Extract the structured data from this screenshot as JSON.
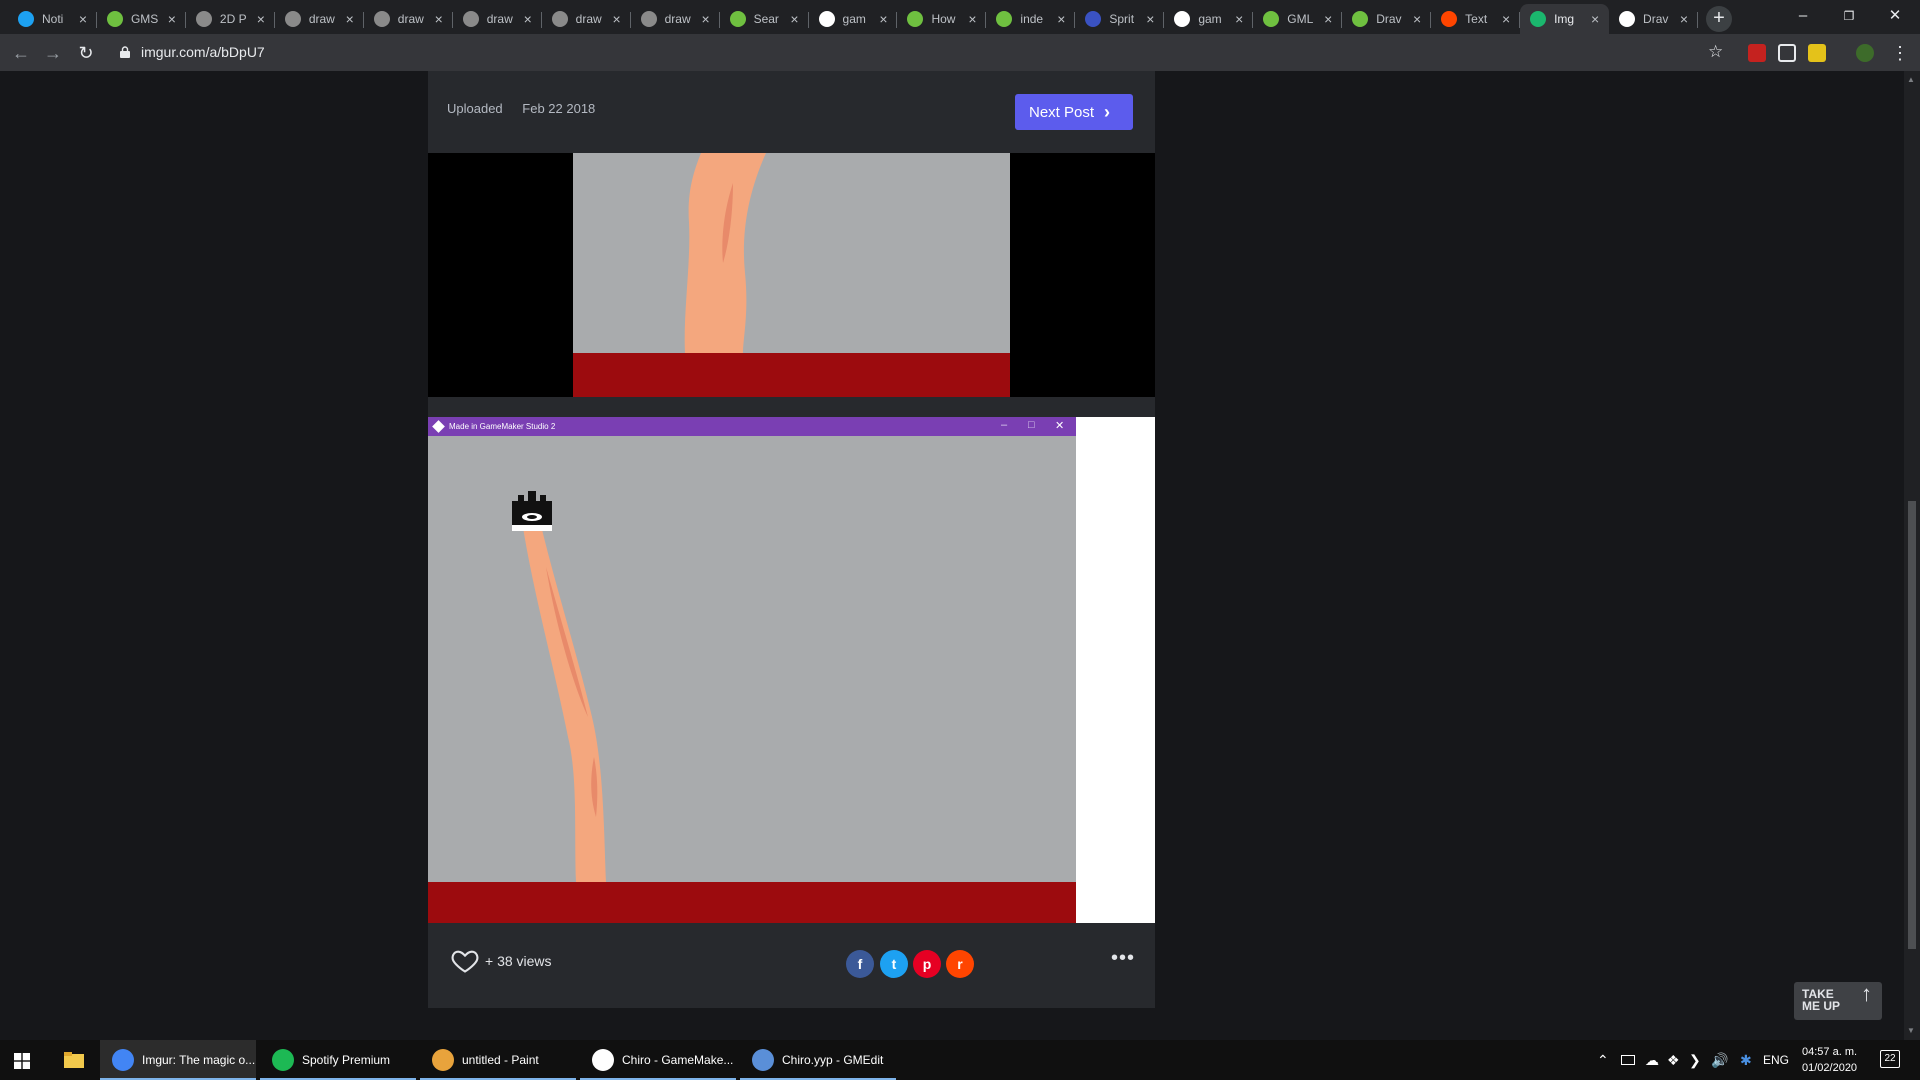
{
  "browser": {
    "tabs": [
      {
        "title": "Noti",
        "favicon": "twitter-icon",
        "color": "#1da1f2"
      },
      {
        "title": "GMS",
        "favicon": "gm-forum-icon",
        "color": "#6fc040"
      },
      {
        "title": "2D P",
        "favicon": "globe-icon",
        "color": "#8a8a8a"
      },
      {
        "title": "draw",
        "favicon": "globe-icon",
        "color": "#8a8a8a"
      },
      {
        "title": "draw",
        "favicon": "globe-icon",
        "color": "#8a8a8a"
      },
      {
        "title": "draw",
        "favicon": "globe-icon",
        "color": "#8a8a8a"
      },
      {
        "title": "draw",
        "favicon": "globe-icon",
        "color": "#8a8a8a"
      },
      {
        "title": "draw",
        "favicon": "globe-icon",
        "color": "#8a8a8a"
      },
      {
        "title": "Sear",
        "favicon": "gm-forum-icon",
        "color": "#6fc040"
      },
      {
        "title": "gam",
        "favicon": "google-icon",
        "color": "#ffffff"
      },
      {
        "title": "How",
        "favicon": "gm-forum-icon",
        "color": "#6fc040"
      },
      {
        "title": "inde",
        "favicon": "gm-forum-icon",
        "color": "#6fc040"
      },
      {
        "title": "Sprit",
        "favicon": "spriters-icon",
        "color": "#3a52c2"
      },
      {
        "title": "gam",
        "favicon": "google-icon",
        "color": "#ffffff"
      },
      {
        "title": "GML",
        "favicon": "gm-forum-icon",
        "color": "#6fc040"
      },
      {
        "title": "Drav",
        "favicon": "gm-forum-icon",
        "color": "#6fc040"
      },
      {
        "title": "Text",
        "favicon": "reddit-icon",
        "color": "#ff4500"
      },
      {
        "title": "Img",
        "favicon": "imgur-icon",
        "color": "#1bb76e",
        "active": true
      },
      {
        "title": "Drav",
        "favicon": "gamemaker-icon",
        "color": "#ffffff"
      }
    ],
    "url": "imgur.com/a/bDpU7"
  },
  "post": {
    "uploaded_label": "Uploaded",
    "uploaded_date": "Feb 22 2018",
    "next_post_label": "Next Post",
    "gm_window_title": "Made in GameMaker Studio 2",
    "views_text": "+  38 views",
    "share_buttons": [
      {
        "name": "facebook-share-button",
        "glyph": "f",
        "color": "#3b5998"
      },
      {
        "name": "twitter-share-button",
        "glyph": "t",
        "color": "#1da1f2"
      },
      {
        "name": "pinterest-share-button",
        "glyph": "p",
        "color": "#e60023"
      },
      {
        "name": "reddit-share-button",
        "glyph": "r",
        "color": "#ff4500"
      }
    ],
    "more_label": "•••",
    "take_me_up": [
      "TAKE",
      "ME UP"
    ]
  },
  "taskbar": {
    "items": [
      {
        "label": "Imgur: The magic o...",
        "icon": "chrome-icon",
        "color": "#4285f4",
        "active": true
      },
      {
        "label": "Spotify Premium",
        "icon": "spotify-icon",
        "color": "#1db954"
      },
      {
        "label": "untitled - Paint",
        "icon": "paint-icon",
        "color": "#e8a33c"
      },
      {
        "label": "Chiro - GameMake...",
        "icon": "gamemaker-icon",
        "color": "#ffffff"
      },
      {
        "label": "Chiro.yyp - GMEdit",
        "icon": "gmedit-icon",
        "color": "#5a8fd8"
      }
    ],
    "language": "ENG",
    "time": "04:57 a. m.",
    "date": "01/02/2020",
    "notifications": "22"
  }
}
